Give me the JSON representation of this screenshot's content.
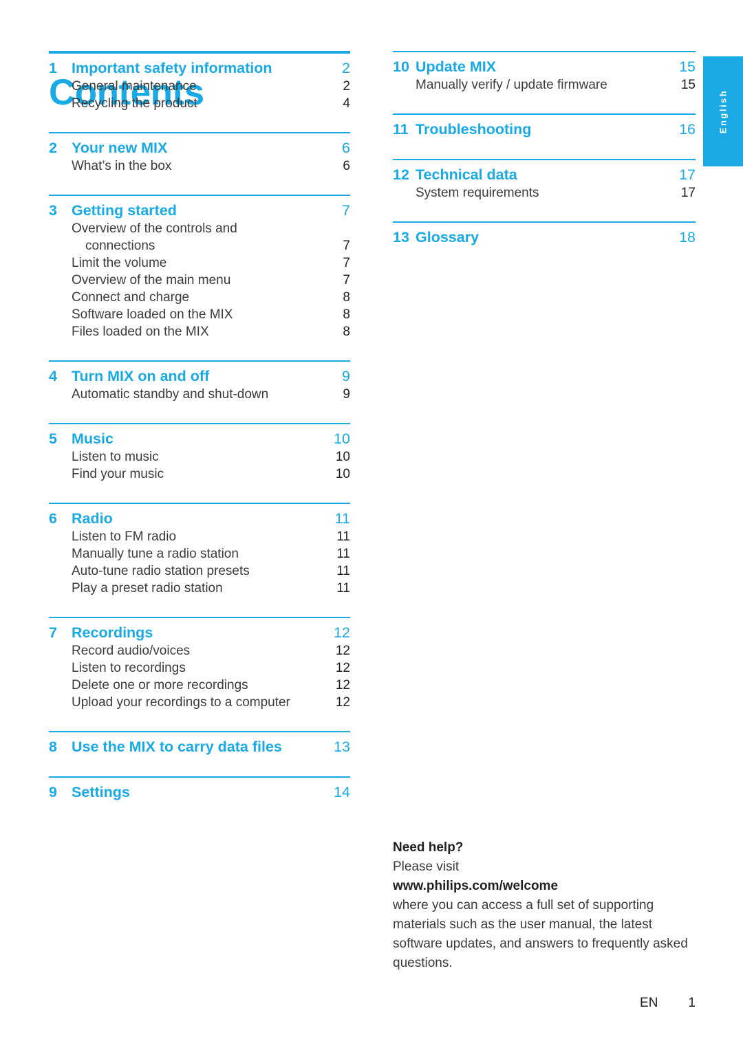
{
  "document": {
    "title": "Contents",
    "language_tab": "English",
    "accent_color": "#19a9e5",
    "text_color": "#231f20"
  },
  "footer": {
    "language_code": "EN",
    "page_number": "1"
  },
  "toc": {
    "left_column": [
      {
        "number": "1",
        "title": "Important safety information",
        "page": "2",
        "rule": "thick",
        "entries": [
          {
            "title": "General maintenance",
            "page": "2",
            "continuation": false
          },
          {
            "title": "Recycling the product",
            "page": "4",
            "continuation": false
          }
        ]
      },
      {
        "number": "2",
        "title": "Your new MIX",
        "page": "6",
        "rule": "thin",
        "entries": [
          {
            "title": "What’s in the box",
            "page": "6",
            "continuation": false
          }
        ]
      },
      {
        "number": "3",
        "title": "Getting started",
        "page": "7",
        "rule": "thin",
        "entries": [
          {
            "title": "Overview of the controls and",
            "page": "",
            "continuation": false
          },
          {
            "title": "connections",
            "page": "7",
            "continuation": true
          },
          {
            "title": "Limit the volume",
            "page": "7",
            "continuation": false
          },
          {
            "title": "Overview of the main menu",
            "page": "7",
            "continuation": false
          },
          {
            "title": "Connect and charge",
            "page": "8",
            "continuation": false
          },
          {
            "title": "Software loaded on the MIX",
            "page": "8",
            "continuation": false
          },
          {
            "title": "Files loaded on the MIX",
            "page": "8",
            "continuation": false
          }
        ]
      },
      {
        "number": "4",
        "title": "Turn MIX on and off",
        "page": "9",
        "rule": "thin",
        "entries": [
          {
            "title": "Automatic standby and shut-down",
            "page": "9",
            "continuation": false
          }
        ]
      },
      {
        "number": "5",
        "title": "Music",
        "page": "10",
        "rule": "thin",
        "entries": [
          {
            "title": "Listen to music",
            "page": "10",
            "continuation": false
          },
          {
            "title": "Find your music",
            "page": "10",
            "continuation": false
          }
        ]
      },
      {
        "number": "6",
        "title": "Radio",
        "page": "11",
        "rule": "thin",
        "entries": [
          {
            "title": "Listen to FM radio",
            "page": "11",
            "continuation": false
          },
          {
            "title": "Manually tune a radio station",
            "page": "11",
            "continuation": false
          },
          {
            "title": "Auto-tune radio station presets",
            "page": "11",
            "continuation": false
          },
          {
            "title": "Play a preset radio station",
            "page": "11",
            "continuation": false
          }
        ]
      },
      {
        "number": "7",
        "title": "Recordings",
        "page": "12",
        "rule": "thin",
        "entries": [
          {
            "title": "Record audio/voices",
            "page": "12",
            "continuation": false
          },
          {
            "title": "Listen to recordings",
            "page": "12",
            "continuation": false
          },
          {
            "title": "Delete one or more recordings",
            "page": "12",
            "continuation": false
          },
          {
            "title": "Upload your recordings to a computer",
            "page": "12",
            "continuation": false
          }
        ]
      },
      {
        "number": "8",
        "title": "Use the MIX to carry data files",
        "page": "13",
        "rule": "thin",
        "entries": []
      },
      {
        "number": "9",
        "title": "Settings",
        "page": "14",
        "rule": "thin",
        "entries": []
      }
    ],
    "right_column": [
      {
        "number": "10",
        "title": "Update MIX",
        "page": "15",
        "rule": "thin",
        "entries": [
          {
            "title": "Manually verify / update firmware",
            "page": "15",
            "continuation": false
          }
        ]
      },
      {
        "number": "11",
        "title": "Troubleshooting",
        "page": "16",
        "rule": "thin",
        "entries": []
      },
      {
        "number": "12",
        "title": "Technical data",
        "page": "17",
        "rule": "thin",
        "entries": [
          {
            "title": "System requirements",
            "page": "17",
            "continuation": false
          }
        ]
      },
      {
        "number": "13",
        "title": "Glossary",
        "page": "18",
        "rule": "thin",
        "entries": []
      }
    ]
  },
  "need_help": {
    "heading": "Need help?",
    "line_please_visit": "Please visit",
    "url": "www.philips.com/welcome",
    "body": "where you can access a full set of supporting materials such as the user manual, the latest software updates, and answers to frequently asked questions."
  }
}
